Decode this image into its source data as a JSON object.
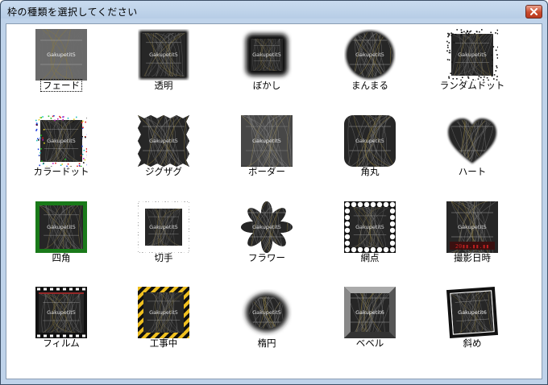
{
  "window": {
    "title": "枠の種類を選択してください"
  },
  "thumbnail_text": "Gakupetit5",
  "frames": [
    {
      "label": "フェード",
      "icon": "fade-frame",
      "focused": true
    },
    {
      "label": "透明",
      "icon": "transparent-frame"
    },
    {
      "label": "ぼかし",
      "icon": "blur-frame"
    },
    {
      "label": "まんまる",
      "icon": "circle-frame"
    },
    {
      "label": "ランダムドット",
      "icon": "random-dot-frame"
    },
    {
      "label": "カラードット",
      "icon": "color-dot-frame"
    },
    {
      "label": "ジグザグ",
      "icon": "zigzag-frame"
    },
    {
      "label": "ボーダー",
      "icon": "border-frame"
    },
    {
      "label": "角丸",
      "icon": "rounded-corner-frame"
    },
    {
      "label": "ハート",
      "icon": "heart-frame"
    },
    {
      "label": "四角",
      "icon": "square-frame"
    },
    {
      "label": "切手",
      "icon": "stamp-frame"
    },
    {
      "label": "フラワー",
      "icon": "flower-frame"
    },
    {
      "label": "網点",
      "icon": "halftone-frame"
    },
    {
      "label": "撮影日時",
      "icon": "datetime-frame"
    },
    {
      "label": "フィルム",
      "icon": "film-frame"
    },
    {
      "label": "工事中",
      "icon": "construction-frame"
    },
    {
      "label": "楕円",
      "icon": "ellipse-frame"
    },
    {
      "label": "ベベル",
      "icon": "bevel-frame",
      "thumb_text": "Gakupetit6"
    },
    {
      "label": "斜め",
      "icon": "tilted-frame",
      "thumb_text": "Gakupetit6"
    }
  ]
}
